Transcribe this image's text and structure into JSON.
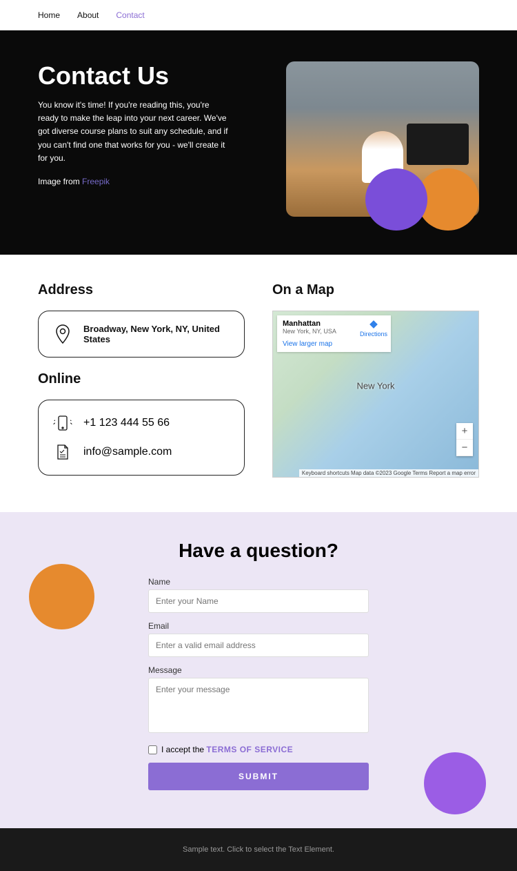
{
  "nav": {
    "home": "Home",
    "about": "About",
    "contact": "Contact"
  },
  "hero": {
    "title": "Contact Us",
    "body": "You know it's time! If you're reading this, you're ready to make the leap into your next career. We've got diverse course plans to suit any schedule, and if you can't find one that works for you - we'll create it for you.",
    "credit_prefix": "Image from ",
    "credit_link": "Freepik"
  },
  "info": {
    "address_h": "Address",
    "address": "Broadway, New York, NY, United States",
    "online_h": "Online",
    "phone": "+1 123 444 55 66",
    "email": "info@sample.com",
    "map_h": "On a Map",
    "map": {
      "title": "Manhattan",
      "sub": "New York, NY, USA",
      "view": "View larger map",
      "dir": "Directions",
      "city": "New York",
      "foot": "Keyboard shortcuts   Map data ©2023 Google   Terms   Report a map error"
    }
  },
  "form": {
    "heading": "Have a question?",
    "name_l": "Name",
    "name_p": "Enter your Name",
    "email_l": "Email",
    "email_p": "Enter a valid email address",
    "msg_l": "Message",
    "msg_p": "Enter your message",
    "accept": "I accept the ",
    "tos": "TERMS OF SERVICE",
    "submit": "SUBMIT"
  },
  "footer": {
    "text": "Sample text. Click to select the Text Element."
  }
}
